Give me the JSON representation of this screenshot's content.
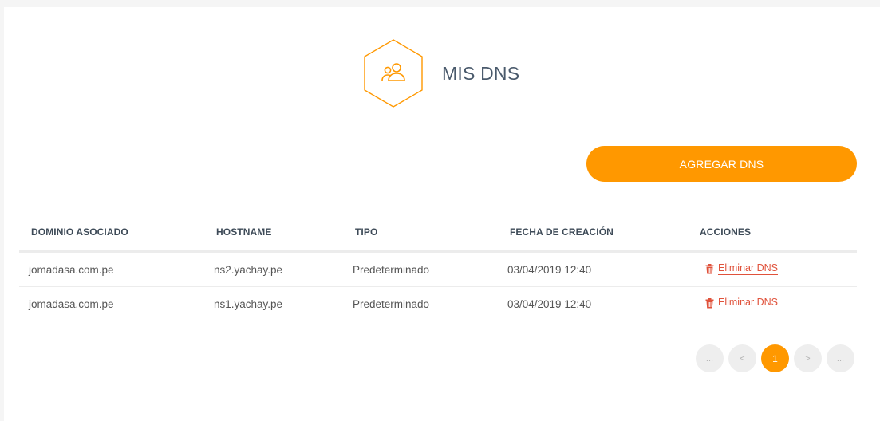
{
  "header": {
    "title": "MIS DNS",
    "icon": "users-icon"
  },
  "actions": {
    "add_label": "AGREGAR DNS"
  },
  "table": {
    "columns": [
      "DOMINIO ASOCIADO",
      "HOSTNAME",
      "TIPO",
      "FECHA DE CREACIÓN",
      "ACCIONES"
    ],
    "rows": [
      {
        "domain": "jomadasa.com.pe",
        "hostname": "ns2.yachay.pe",
        "type": "Predeterminado",
        "created": "03/04/2019 12:40",
        "action": "Eliminar DNS"
      },
      {
        "domain": "jomadasa.com.pe",
        "hostname": "ns1.yachay.pe",
        "type": "Predeterminado",
        "created": "03/04/2019 12:40",
        "action": "Eliminar DNS"
      }
    ]
  },
  "pagination": {
    "first": "...",
    "prev": "<",
    "current": "1",
    "next": ">",
    "last": "..."
  },
  "colors": {
    "accent": "#ff9800",
    "danger": "#e0523b",
    "title": "#4a5a6c"
  }
}
